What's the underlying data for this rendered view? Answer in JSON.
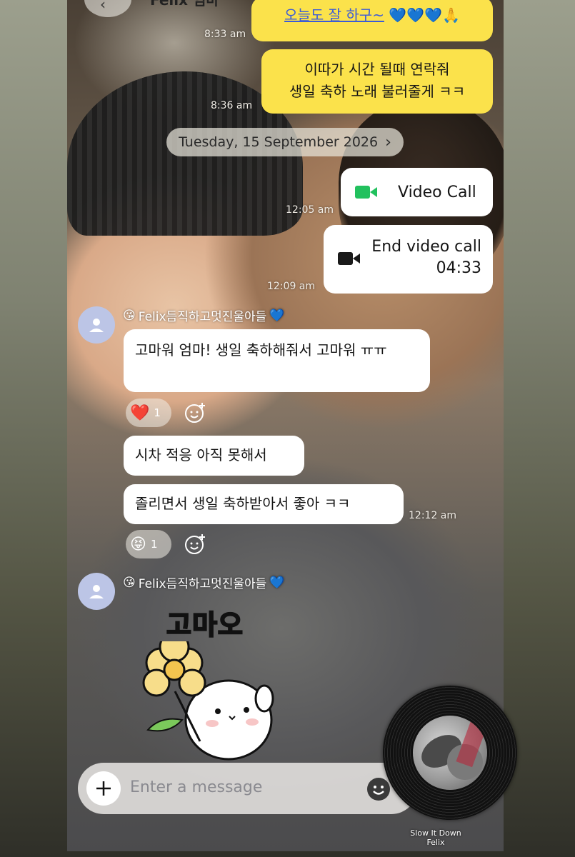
{
  "header": {
    "title_partial": "Felix 엄마"
  },
  "messages": {
    "top_partial": "오늘도 잘 하구~",
    "top_emojis": "💙💙💙🙏",
    "top_time": "8:33 am",
    "m2_line1": "이따가 시간 될때 연락줘",
    "m2_line2": "생일 축하 노래 불러줄게 ㅋㅋ",
    "m2_time": "8:36 am",
    "date_label": "Tuesday, 15 September 2026",
    "date_chevron": "›",
    "call1_label": "Video Call",
    "call1_time": "12:05 am",
    "call2_label": "End video call",
    "call2_duration": "04:33",
    "call2_time": "12:09 am",
    "sender_name": "Felix듬직하고멋진울아들",
    "sender_emoji": "😘",
    "sender_heart": "💙",
    "r1_text": "고마워 엄마! 생일 축하해줘서 고마워 ㅠㅠ",
    "r1_reaction_emoji": "❤️",
    "r1_reaction_count": "1",
    "r2_text": "시차 적응 아직 못해서",
    "r3_text": "졸리면서 생일 축하받아서 좋아 ㅋㅋ",
    "r3_time": "12:12 am",
    "r3_reaction_emoji": "😝",
    "r3_reaction_count": "1",
    "sticker_text": "고마오"
  },
  "input": {
    "placeholder": "Enter a message"
  },
  "music": {
    "song_title": "Slow It Down",
    "artist": "Felix"
  },
  "colors": {
    "my_bubble": "#fbe24b",
    "their_bubble": "#ffffff",
    "call_icon_green": "#22c15e",
    "avatar": "#bcc5e6"
  },
  "icons": [
    "back-icon",
    "search-icon",
    "phone-icon",
    "menu-icon",
    "chevron-right-icon",
    "video-camera-icon",
    "person-icon",
    "heart-icon",
    "add-reaction-icon",
    "plus-icon",
    "emoji-icon",
    "vinyl-record"
  ]
}
